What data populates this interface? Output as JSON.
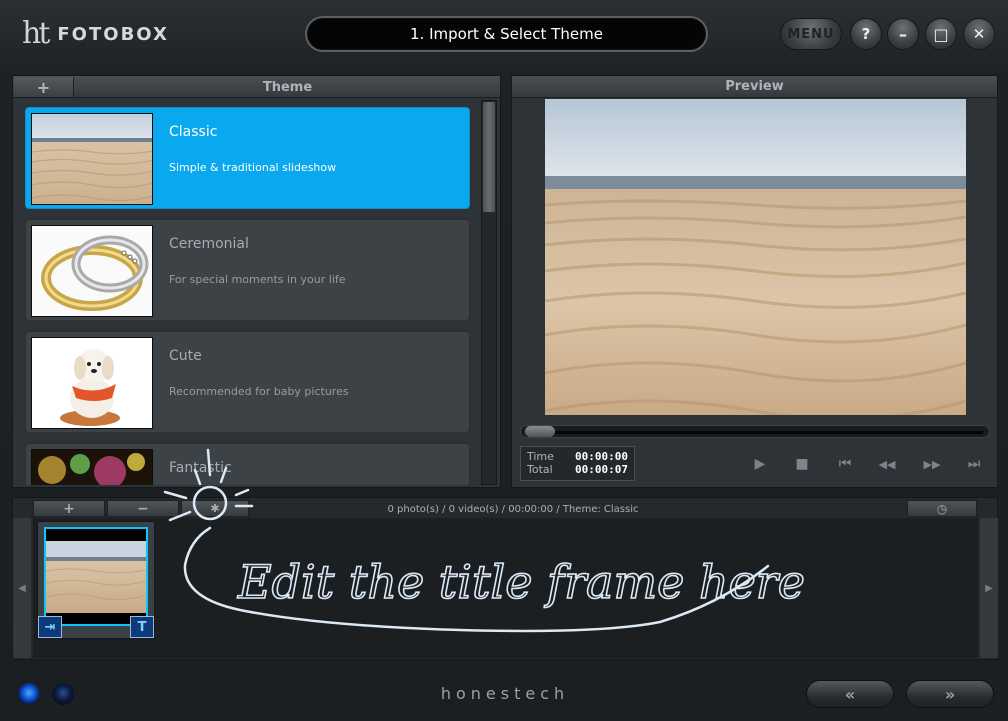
{
  "app": {
    "logo_mark": "ht",
    "name": "FOTOBOX"
  },
  "step_title": "1. Import & Select Theme",
  "window_buttons": {
    "menu": "MENU",
    "help": "?",
    "minimize": "–",
    "maximize": "□",
    "close": "✕"
  },
  "theme_panel": {
    "add_label": "+",
    "title": "Theme",
    "items": [
      {
        "name": "Classic",
        "description": "Simple & traditional slideshow",
        "selected": true
      },
      {
        "name": "Ceremonial",
        "description": "For special moments in your life",
        "selected": false
      },
      {
        "name": "Cute",
        "description": "Recommended for baby pictures",
        "selected": false
      },
      {
        "name": "Fantastic",
        "description": "",
        "selected": false
      }
    ]
  },
  "preview_panel": {
    "title": "Preview",
    "time_label": "Time",
    "time_value": "00:00:00",
    "total_label": "Total",
    "total_value": "00:00:07",
    "seek_position": 0
  },
  "controls": {
    "play": "▶",
    "stop": "■",
    "first": "⏮",
    "rewind": "◀◀",
    "forward": "▶▶",
    "last": "⏭"
  },
  "storyboard": {
    "add_label": "+",
    "remove_label": "−",
    "effect_label": "✱",
    "clock_label": "◷",
    "info": "0 photo(s) / 0 video(s) / 00:00:00 / Theme: Classic",
    "left_arrow": "◀",
    "right_arrow": "▶",
    "frame_left_btn": "⇥",
    "frame_right_btn": "T"
  },
  "annotation": {
    "text": "Edit the title frame here",
    "color": "#b9d9f2"
  },
  "footer": {
    "brand": "honestech",
    "prev": "«",
    "next": "»"
  },
  "colors": {
    "accent": "#0aa9ef",
    "frame_border": "#0cc5ff"
  }
}
